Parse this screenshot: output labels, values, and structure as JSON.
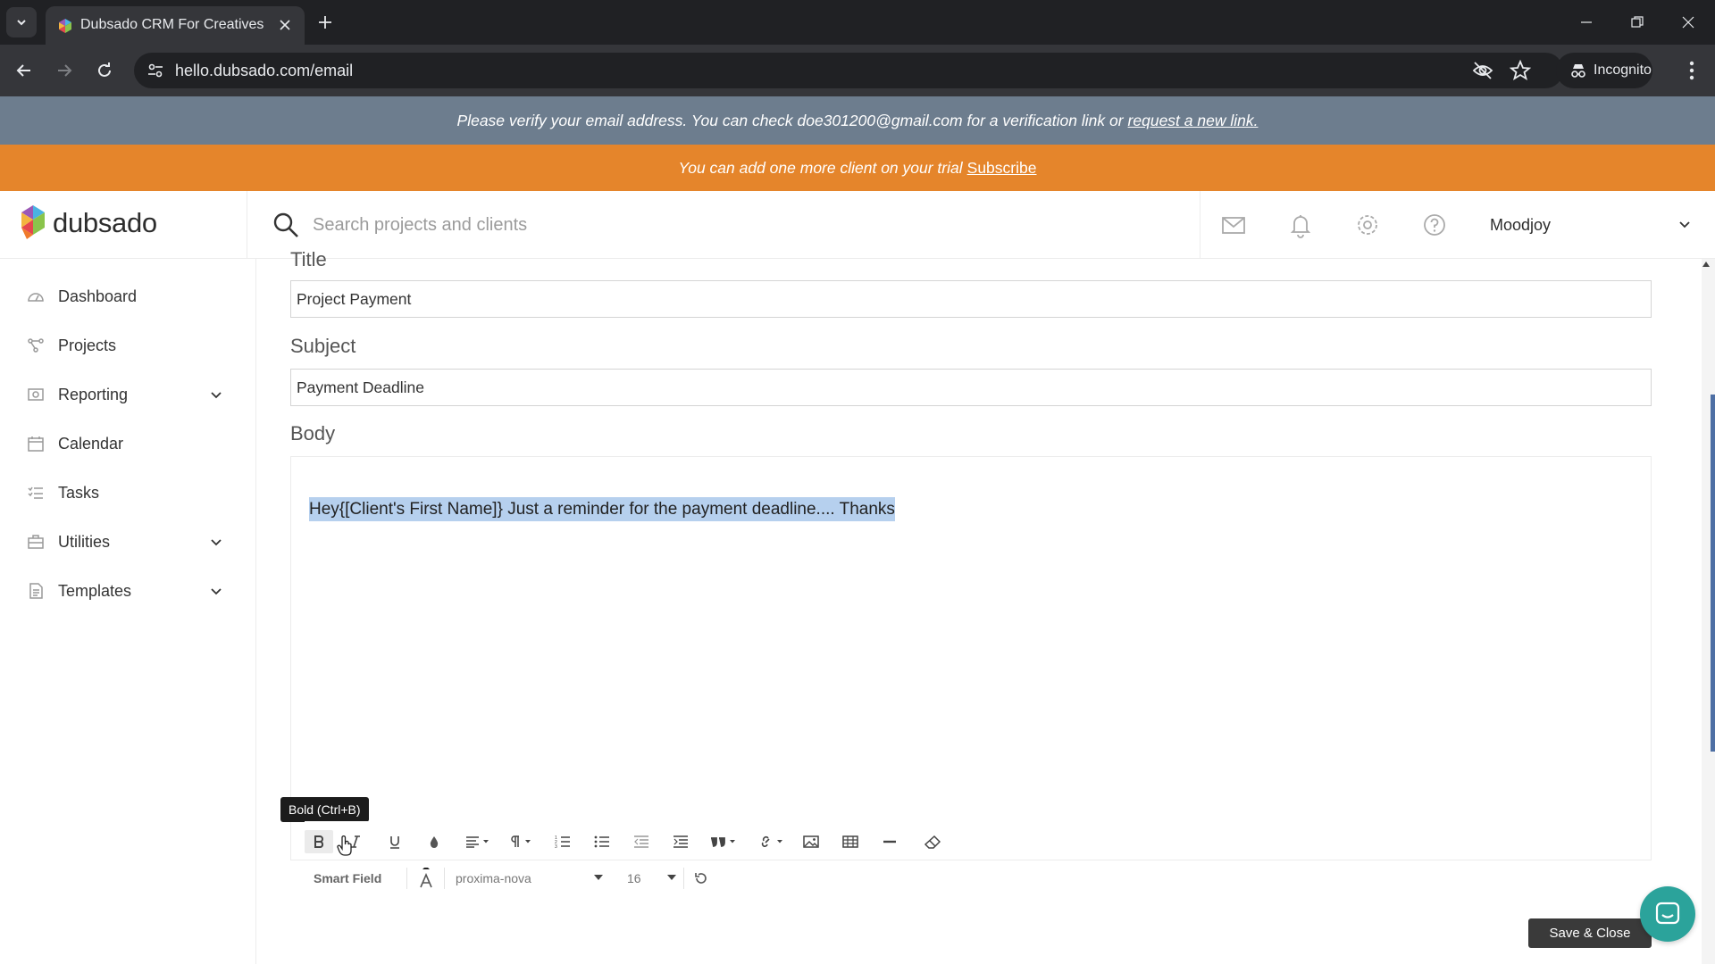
{
  "browser": {
    "tab_title": "Dubsado CRM For Creatives",
    "url": "hello.dubsado.com/email",
    "incognito_label": "Incognito"
  },
  "banners": {
    "verify_text": "Please verify your email address. You can check doe301200@gmail.com for a verification link or",
    "verify_link": "request a new link.",
    "trial_text": "You can add one more client on your trial",
    "trial_link": "Subscribe"
  },
  "header": {
    "logo_text": "dubsado",
    "search_placeholder": "Search projects and clients",
    "user_name": "Moodjoy"
  },
  "sidebar": {
    "items": [
      {
        "label": "Dashboard"
      },
      {
        "label": "Projects"
      },
      {
        "label": "Reporting"
      },
      {
        "label": "Calendar"
      },
      {
        "label": "Tasks"
      },
      {
        "label": "Utilities"
      },
      {
        "label": "Templates"
      }
    ]
  },
  "form": {
    "title_label": "Title",
    "title_value": "Project Payment",
    "subject_label": "Subject",
    "subject_value": "Payment Deadline",
    "body_label": "Body",
    "body_text": "Hey{[Client's First Name]} Just a reminder for the payment deadline.... Thanks",
    "tooltip": "Bold (Ctrl+B)",
    "smart_field_label": "Smart Field",
    "font_family": "proxima-nova",
    "font_size": "16",
    "save_label": "Save & Close"
  },
  "colors": {
    "verify_banner": "#6d7d8e",
    "trial_banner": "#e5852b",
    "selection": "#b6d0ee",
    "chat": "#2ba39b"
  }
}
